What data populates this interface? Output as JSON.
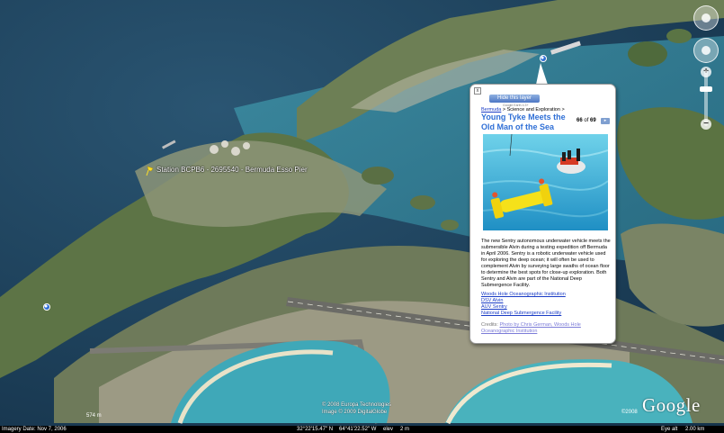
{
  "map": {
    "placemark_label": "Station BCPB6 - 2695540 - Bermuda Esso Pier",
    "copyright_lines": [
      "© 2008 Europa Technologies",
      "Image © 2009 DigitalGlobe"
    ],
    "logo_text": "Google",
    "logo_year": "©2008",
    "scale_label": "574 m"
  },
  "balloon": {
    "close_label": "x",
    "hide_button_label": "Hide this layer",
    "hide_subtext": "Google Earth 4.3+",
    "breadcrumb_link": "Bermuda",
    "breadcrumb_rest": " > Science and Exploration >",
    "title": "Young Tyke Meets the Old Man of the Sea",
    "counter_current": "66",
    "counter_of": "of",
    "counter_total": "69",
    "next_label": "▸",
    "body": "The new Sentry autonomous underwater vehicle meets the submersible Alvin during a testing expedition off Bermuda in April 2006. Sentry is a robotic underwater vehicle used for exploring the deep ocean; it will often be used to complement Alvin by surveying large swaths of ocean floor to determine the best spots for close-up exploration. Both Sentry and Alvin are part of the National Deep Submergence Facility.",
    "links": [
      "Woods Hole Oceanographic Institution",
      "DSV Alvin",
      "AUV Sentry",
      "National Deep Submergence Facility"
    ],
    "credits_prefix": "Credits: ",
    "credits_link": "Photo by Chris German, Woods Hole Oceanographic Institution"
  },
  "status_bar": {
    "imagery_date": "Imagery Date: Nov 7, 2006",
    "lat": "32°22'15.47\" N",
    "lon": "64°41'22.52\" W",
    "elev": "elev",
    "elev_value": "2 m",
    "eye_alt": "Eye alt",
    "eye_alt_value": "2.00 km"
  },
  "colors": {
    "ocean": "#1f4a66",
    "shallow_water": "#5bb0b8",
    "land": "#4f6b3a",
    "balloon_title": "#2f6fd6",
    "link": "#1a3cc6"
  }
}
